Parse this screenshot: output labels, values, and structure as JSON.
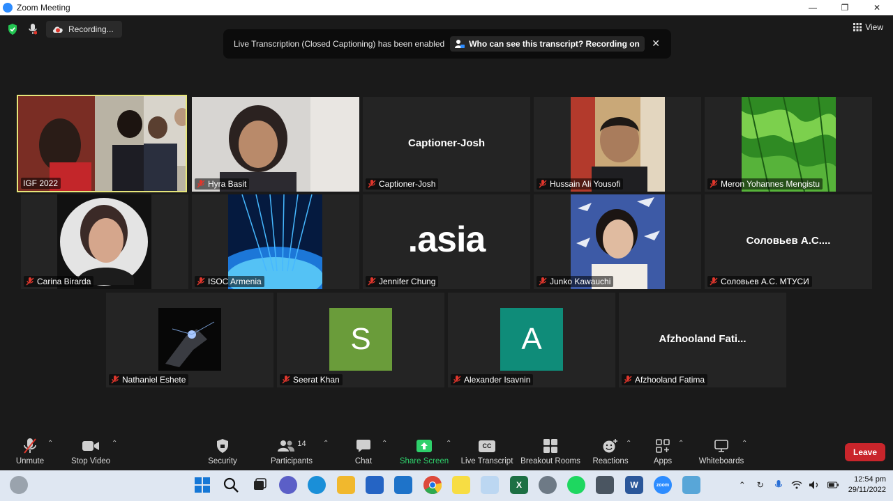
{
  "window": {
    "title": "Zoom Meeting"
  },
  "recording": {
    "label": "Recording..."
  },
  "view": {
    "label": "View"
  },
  "banner": {
    "message": "Live Transcription (Closed Captioning) has been enabled",
    "who_label": "Who can see this transcript? Recording on"
  },
  "tiles": [
    {
      "name": "IGF 2022"
    },
    {
      "name": "Hyra Basit"
    },
    {
      "name": "Captioner-Josh",
      "display": "Captioner-Josh"
    },
    {
      "name": "Hussain Ali Yousofi"
    },
    {
      "name": "Meron Yohannes Mengistu"
    },
    {
      "name": "Carina Birarda"
    },
    {
      "name": "ISOC Armenia"
    },
    {
      "name": "Jennifer Chung",
      "logo_text": ".asia"
    },
    {
      "name": "Junko Kawauchi"
    },
    {
      "name": "Соловьев А.С. МТУСИ",
      "display": "Соловьев  А.С...."
    },
    {
      "name": "Nathaniel Eshete"
    },
    {
      "name": "Seerat Khan",
      "avatar_letter": "S",
      "avatar_color": "#6a9c3a"
    },
    {
      "name": "Alexander Isavnin",
      "avatar_letter": "A",
      "avatar_color": "#0f8c79"
    },
    {
      "name": "Afzhooland Fatima",
      "display": "Afzhooland  Fati..."
    }
  ],
  "toolbar": {
    "unmute": "Unmute",
    "stop_video": "Stop Video",
    "security": "Security",
    "participants": "Participants",
    "participants_count": "14",
    "chat": "Chat",
    "share_screen": "Share Screen",
    "live_transcript": "Live Transcript",
    "cc_badge": "CC",
    "breakout_rooms": "Breakout Rooms",
    "reactions": "Reactions",
    "apps": "Apps",
    "whiteboards": "Whiteboards",
    "leave": "Leave"
  },
  "taskbar": {
    "time": "12:54 pm",
    "date": "29/11/2022",
    "zoom_label": "zoom"
  },
  "colors": {
    "active_outline": "#e6e67a",
    "share_green": "#2ed06b",
    "leave_red": "#c9252b"
  }
}
